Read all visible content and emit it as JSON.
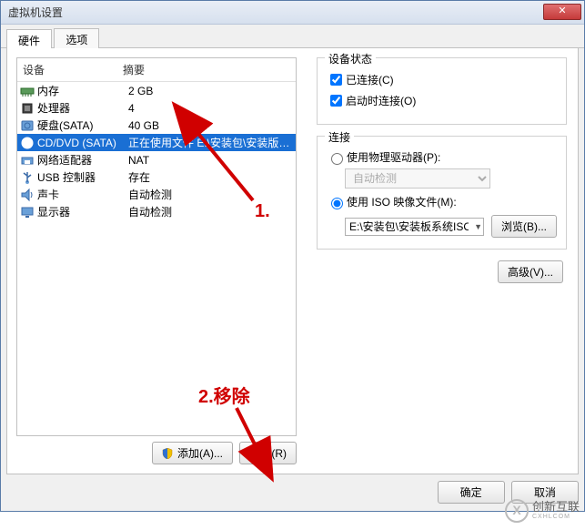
{
  "window": {
    "title": "虚拟机设置",
    "close": "✕"
  },
  "tabs": [
    {
      "label": "硬件",
      "active": true
    },
    {
      "label": "选项",
      "active": false
    }
  ],
  "device_header": {
    "device": "设备",
    "summary": "摘要"
  },
  "devices": [
    {
      "icon": "memory-icon",
      "name": "内存",
      "summary": "2 GB"
    },
    {
      "icon": "cpu-icon",
      "name": "处理器",
      "summary": "4"
    },
    {
      "icon": "hdd-icon",
      "name": "硬盘(SATA)",
      "summary": "40 GB"
    },
    {
      "icon": "cd-icon",
      "name": "CD/DVD (SATA)",
      "summary": "正在使用文件 E:\\安装包\\安装版系统..."
    },
    {
      "icon": "nic-icon",
      "name": "网络适配器",
      "summary": "NAT"
    },
    {
      "icon": "usb-icon",
      "name": "USB 控制器",
      "summary": "存在"
    },
    {
      "icon": "sound-icon",
      "name": "声卡",
      "summary": "自动检测"
    },
    {
      "icon": "display-icon",
      "name": "显示器",
      "summary": "自动检测"
    }
  ],
  "selected_device_index": 3,
  "left_buttons": {
    "add": "添加(A)...",
    "remove": "移除(R)"
  },
  "right": {
    "status_title": "设备状态",
    "status_connected": "已连接(C)",
    "status_connect_on": "启动时连接(O)",
    "conn_title": "连接",
    "use_physical": "使用物理驱动器(P):",
    "physical_value": "自动检测",
    "use_iso": "使用 ISO 映像文件(M):",
    "iso_value": "E:\\安装包\\安装板系统ISO\\m",
    "browse": "浏览(B)...",
    "advanced": "高级(V)..."
  },
  "bottom": {
    "ok": "确定",
    "cancel": "取消"
  },
  "annotations": {
    "one": "1.",
    "two": "2.移除"
  },
  "watermark": {
    "brand": "创新互联",
    "sub": "CXHLCOM"
  }
}
